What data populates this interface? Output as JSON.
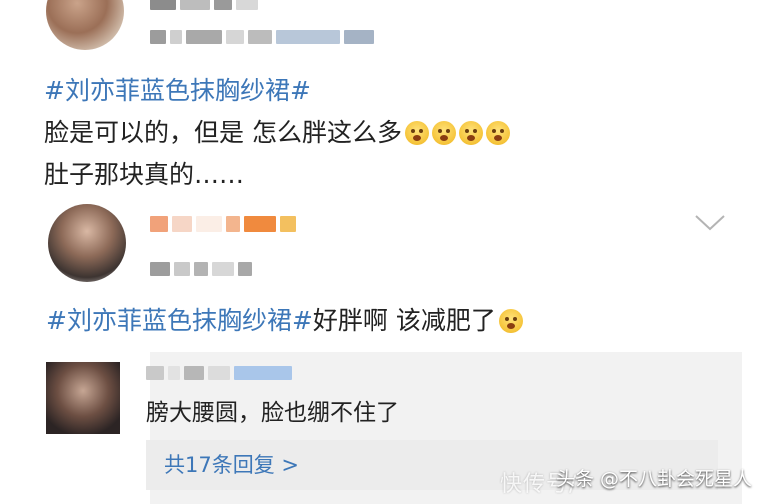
{
  "post1": {
    "line1": "#刘亦菲蓝色抹胸纱裙#",
    "line2": "脸是可以的，但是 怎么胖这么多",
    "line3": "肚子那块真的……"
  },
  "post2": {
    "hashtag": "#刘亦菲蓝色抹胸纱裙#",
    "text": "好胖啊 该减肥了"
  },
  "reply": {
    "text": "膀大腰圆，脸也绷不住了",
    "count_label": "共17条回复 >"
  },
  "icons": {
    "expand": "chevron-down-icon",
    "emoji_flushed": "flushed-face-emoji",
    "emoji_sad": "sad-sweat-face-emoji"
  },
  "footer": {
    "watermark": "快传号/",
    "source": "头条 @不八卦会死星人"
  },
  "colors": {
    "hashtag": "#3d77b8",
    "text": "#222222",
    "reply_bg": "#f2f2f2"
  }
}
